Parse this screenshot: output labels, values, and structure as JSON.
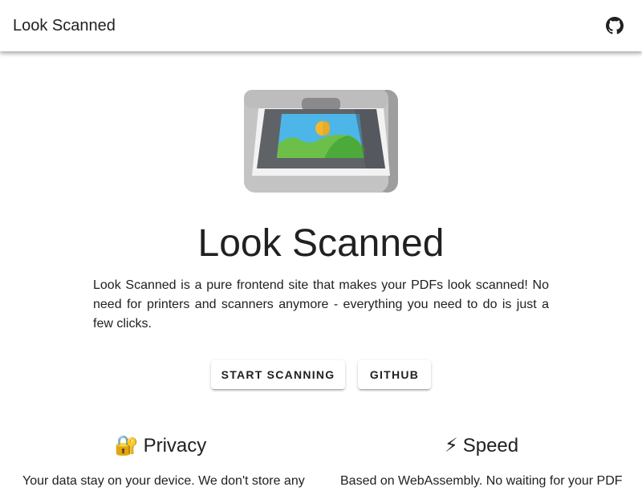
{
  "appbar": {
    "title": "Look Scanned",
    "github_icon": "github-icon"
  },
  "hero": {
    "image_icon": "scanner-illustration",
    "title": "Look Scanned",
    "description": "Look Scanned is a pure frontend site that makes your PDFs look scanned! No need for printers and scanners anymore - everything you need to do is just a few clicks."
  },
  "buttons": {
    "start_label": "START SCANNING",
    "github_label": "GITHUB"
  },
  "features": [
    {
      "emoji": "🔐",
      "title": "Privacy",
      "text": "Your data stay on your device. We don't store any"
    },
    {
      "emoji": "⚡",
      "title": "Speed",
      "text": "Based on WebAssembly. No waiting for your PDF"
    }
  ],
  "colors": {
    "scanner_body": "#bdbdbd",
    "scanner_glass": "#5f6368",
    "sky": "#4db6e8",
    "hill": "#6cc04a",
    "sun": "#f5b731"
  }
}
